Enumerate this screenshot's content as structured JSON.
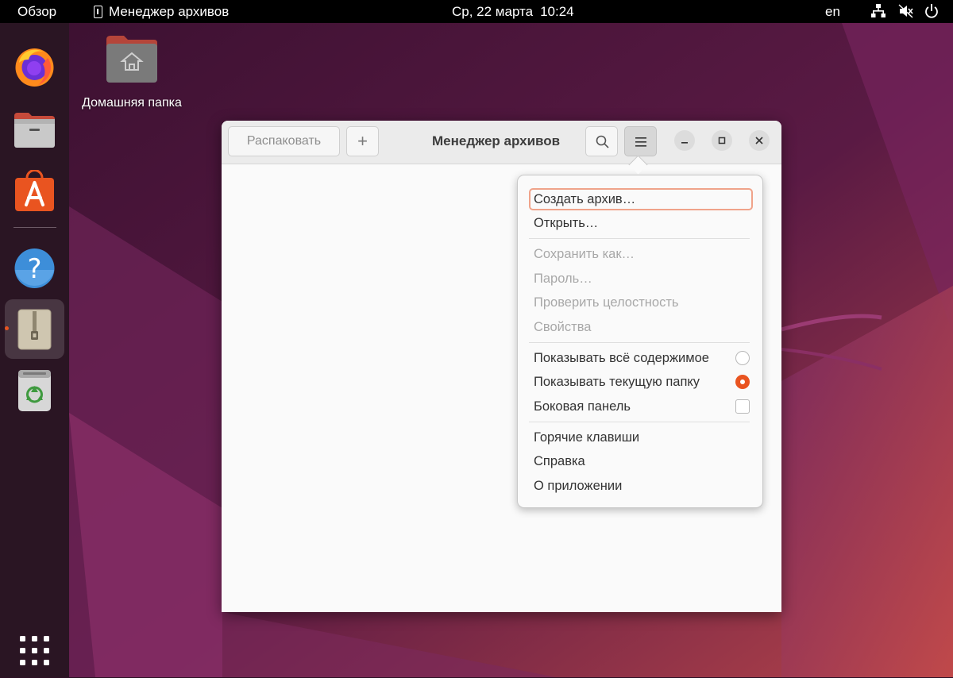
{
  "topbar": {
    "overview": "Обзор",
    "app_name": "Менеджер архивов",
    "date": "Ср, 22 марта",
    "time": "10:24",
    "lang": "en",
    "icons": [
      "network-icon",
      "volume-muted-icon",
      "power-icon"
    ]
  },
  "dock": {
    "items": [
      "firefox-icon",
      "files-icon",
      "software-icon",
      "help-icon",
      "archive-manager-icon",
      "trash-icon"
    ],
    "active": "archive-manager-icon",
    "show_apps": "apps-grid-icon"
  },
  "desktop": {
    "home_label": "Домашняя папка"
  },
  "window": {
    "title": "Менеджер архивов",
    "extract_label": "Распаковать",
    "add_label": "+"
  },
  "menu": {
    "create": "Создать архив…",
    "open": "Открыть…",
    "save_as": "Сохранить как…",
    "password": "Пароль…",
    "test": "Проверить целостность",
    "properties": "Свойства",
    "show_all": "Показывать всё содержимое",
    "show_folder": "Показывать текущую папку",
    "sidebar": "Боковая панель",
    "shortcuts": "Горячие клавиши",
    "help": "Справка",
    "about": "О приложении",
    "selected_view": "show_folder",
    "sidebar_checked": false
  },
  "colors": {
    "accent": "#e95420",
    "topbar": "#000000",
    "dock": "#2a1523"
  }
}
